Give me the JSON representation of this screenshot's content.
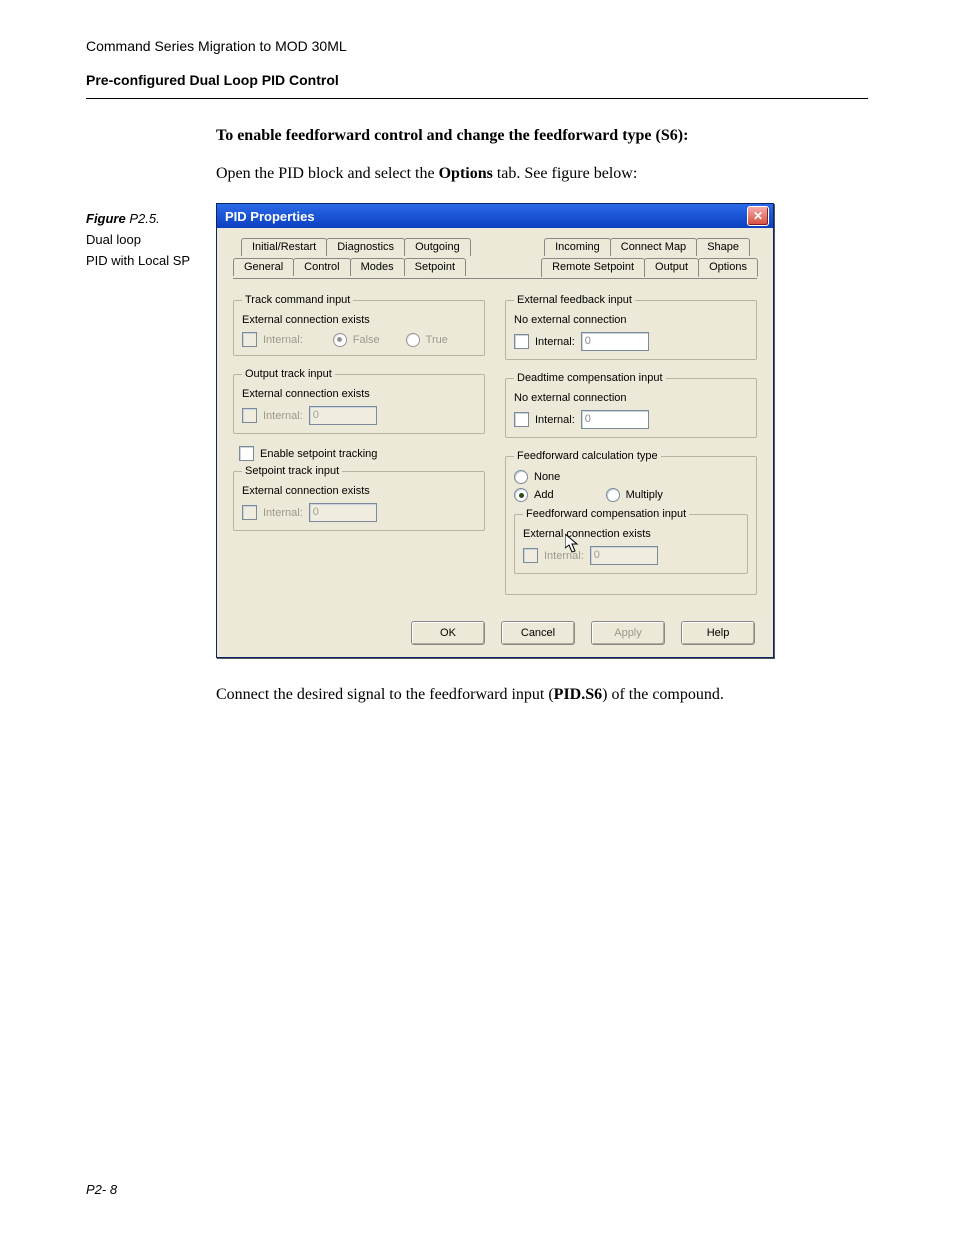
{
  "doc": {
    "running_head": "Command Series Migration to MOD 30ML",
    "section": "Pre-configured Dual Loop PID Control",
    "heading": "To enable feedforward control and change the feedforward type (S6):",
    "open_line_a": "Open the PID block and select the ",
    "open_line_bold": "Options",
    "open_line_b": " tab. See figure below:",
    "figure_label": "Figure ",
    "figure_num": "P2.5.",
    "caption_l1": "Dual loop",
    "caption_l2": "PID with Local SP",
    "after_a": "Connect the desired signal to the feedforward input (",
    "after_bold": "PID.S6",
    "after_b": ") of the compound.",
    "page_num": "P2- 8"
  },
  "dlg": {
    "title": "PID Properties",
    "tabs_row1_left": [
      "Initial/Restart",
      "Diagnostics",
      "Outgoing"
    ],
    "tabs_row1_right": [
      "Incoming",
      "Connect Map",
      "Shape"
    ],
    "tabs_row2_left": [
      "General",
      "Control",
      "Modes",
      "Setpoint"
    ],
    "tabs_row2_right": [
      "Remote Setpoint",
      "Output",
      "Options"
    ],
    "track_cmd": {
      "legend": "Track command input",
      "note": "External connection exists",
      "internal": "Internal:",
      "false": "False",
      "true": "True"
    },
    "out_track": {
      "legend": "Output track input",
      "note": "External connection exists",
      "internal": "Internal:",
      "val": "0"
    },
    "enable_sp": "Enable setpoint tracking",
    "sp_track": {
      "legend": "Setpoint track input",
      "note": "External connection exists",
      "internal": "Internal:",
      "val": "0"
    },
    "ext_fb": {
      "legend": "External feedback input",
      "note": "No external connection",
      "internal": "Internal:",
      "val": "0"
    },
    "dead": {
      "legend": "Deadtime compensation input",
      "note": "No external connection",
      "internal": "Internal:",
      "val": "0"
    },
    "ffcalc": {
      "legend": "Feedforward calculation type",
      "none": "None",
      "add": "Add",
      "mult": "Multiply"
    },
    "ffcomp": {
      "legend": "Feedforward compensation input",
      "note": "External connection exists",
      "internal": "Internal:",
      "val": "0"
    },
    "buttons": {
      "ok": "OK",
      "cancel": "Cancel",
      "apply": "Apply",
      "help": "Help"
    }
  }
}
